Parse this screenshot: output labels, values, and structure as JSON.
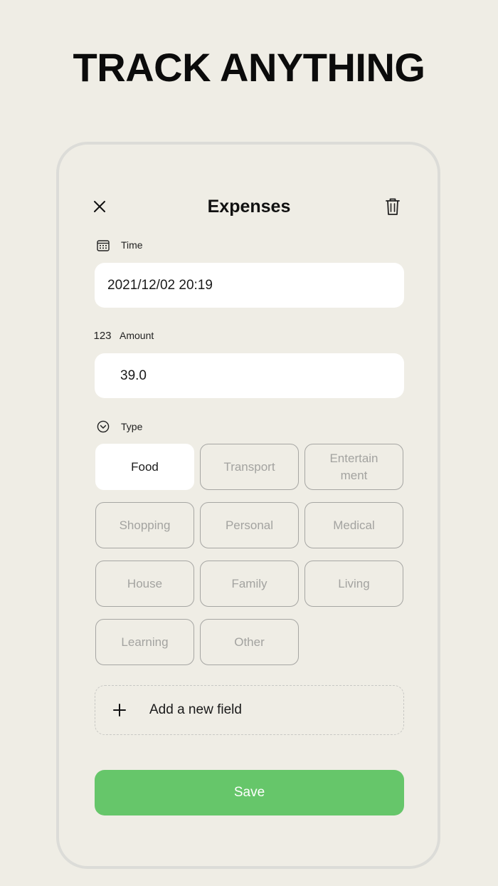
{
  "headline": "TRACK ANYTHING",
  "form": {
    "title": "Expenses",
    "time": {
      "label": "Time",
      "icon": "calendar-icon",
      "value": "2021/12/02 20:19"
    },
    "amount": {
      "label": "Amount",
      "icon_text": "123",
      "value": "39.0"
    },
    "type": {
      "label": "Type",
      "icon": "chevron-circle-down-icon",
      "selected": "Food",
      "options": [
        "Food",
        "Transport",
        "Entertain\nment",
        "Shopping",
        "Personal",
        "Medical",
        "House",
        "Family",
        "Living",
        "Learning",
        "Other"
      ]
    },
    "add_field_label": "Add a new field",
    "save_label": "Save"
  },
  "colors": {
    "background": "#efede5",
    "accent_green": "#66c66a",
    "chip_border": "#a6a6a3",
    "chip_text": "#a3a3a0"
  },
  "icons": {
    "close": "close-icon",
    "trash": "trash-icon",
    "add": "plus-icon"
  }
}
